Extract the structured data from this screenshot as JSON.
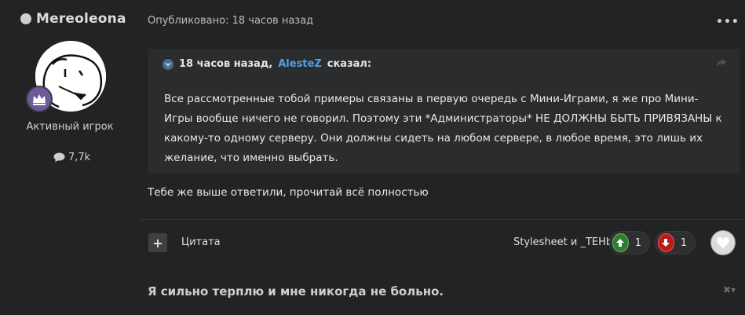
{
  "author": {
    "name": "Mereoleona",
    "rank": "Активный игрок",
    "post_count": "7,7k"
  },
  "post": {
    "date": "Опубликовано: 18 часов назад",
    "more_label": "•••",
    "quote": {
      "time": "18 часов назад,",
      "author": "AlesteZ",
      "said": "сказал:",
      "body": "Все рассмотренные тобой примеры связаны в первую очередь с Мини-Играми, я же про Мини-Игры вообще ничего не говорил. Поэтому эти *Администраторы* НЕ ДОЛЖНЫ БЫТЬ ПРИВЯЗАНЫ к какому-то одному серверу. Они должны сидеть на любом сервере, в любое время, это лишь их желание, что именно выбрать."
    },
    "reply": "Тебе же выше ответили, прочитай всё полностью"
  },
  "actions": {
    "quote_plus": "+",
    "quote_label": "Цитата",
    "reactors": "Stylesheet и _TEHb_",
    "upvotes": "1",
    "downvotes": "1"
  },
  "signature": {
    "text": "Я сильно терплю и мне никогда не больно.",
    "close_label": "✖▾"
  },
  "colors": {
    "background": "#222324",
    "quote_bg": "#2b2c2e",
    "link": "#4fa0e8",
    "upvote": "#2e7d32",
    "downvote": "#b71c1c"
  },
  "icons": {
    "online": "online-status-dot",
    "rank_badge": "crown-badge-icon",
    "posts": "speech-bubble-icon",
    "quote_toggle": "chevron-down-icon",
    "quote_share": "share-arrow-icon",
    "upvote": "arrow-up-icon",
    "downvote": "arrow-down-icon",
    "like": "heart-icon"
  }
}
